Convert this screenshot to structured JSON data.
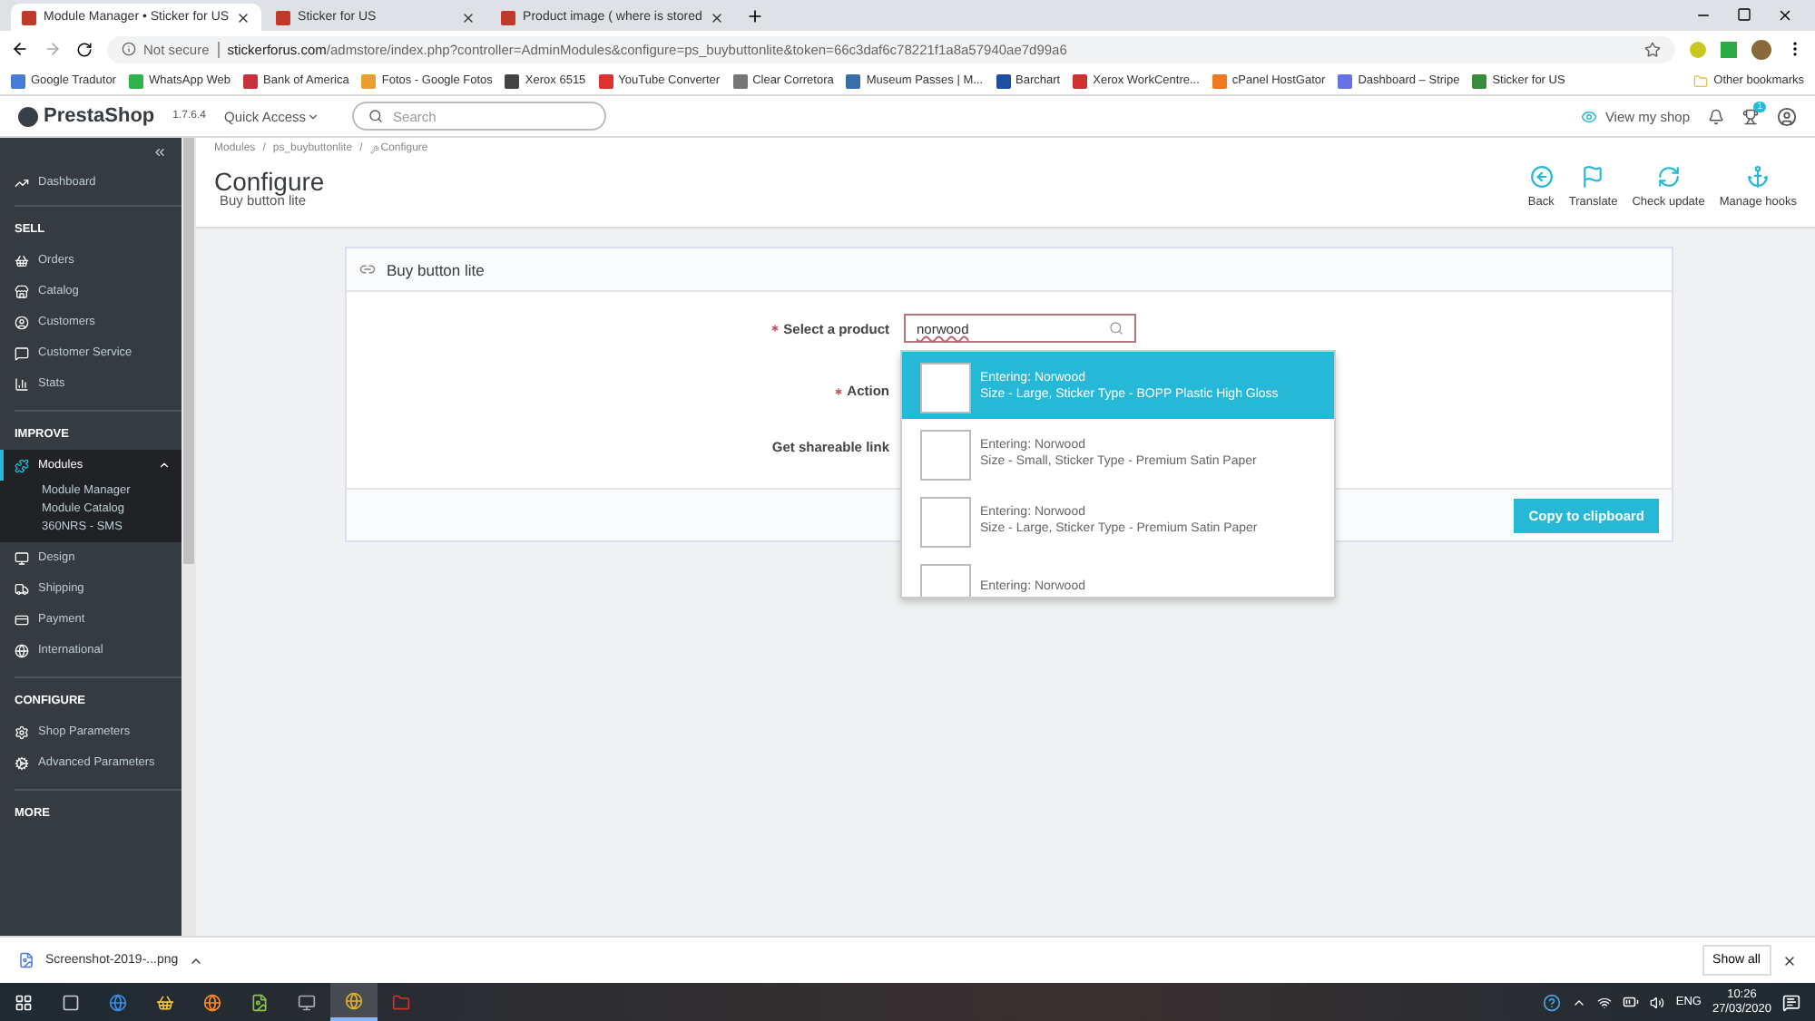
{
  "browser": {
    "tabs": [
      {
        "title": "Module Manager • Sticker for US",
        "selected": true
      },
      {
        "title": "Sticker for US",
        "selected": false
      },
      {
        "title": "Product image ( where is stored",
        "selected": false
      }
    ],
    "security": "Not secure",
    "url_domain": "stickerforus.com",
    "url_path": "/admstore/index.php?controller=AdminModules&configure=ps_buybuttonlite&token=66c3daf6c78221f1a8a57940ae7d99a6",
    "bookmarks": [
      {
        "label": "Google Tradutor",
        "color": "#4a7bd8"
      },
      {
        "label": "WhatsApp Web",
        "color": "#2fb34a"
      },
      {
        "label": "Bank of America",
        "color": "#c8323c"
      },
      {
        "label": "Fotos - Google Fotos",
        "color": "#e8a02a"
      },
      {
        "label": "Xerox 6515",
        "color": "#444444"
      },
      {
        "label": "YouTube Converter",
        "color": "#e03030"
      },
      {
        "label": "Clear Corretora",
        "color": "#777777"
      },
      {
        "label": "Museum Passes | M...",
        "color": "#3a6ea8"
      },
      {
        "label": "Barchart",
        "color": "#1e4ea0"
      },
      {
        "label": "Xerox WorkCentre...",
        "color": "#d03030"
      },
      {
        "label": "cPanel HostGator",
        "color": "#f07a20"
      },
      {
        "label": "Dashboard – Stripe",
        "color": "#6772e5"
      },
      {
        "label": "Sticker for US",
        "color": "#3c8a3c"
      }
    ],
    "other_bookmarks": "Other bookmarks"
  },
  "header": {
    "logo": "PrestaShop",
    "version": "1.7.6.4",
    "quick_access": "Quick Access",
    "search": {
      "placeholder": "Search"
    },
    "view_shop": "View my shop",
    "trophy_badge": "1"
  },
  "sidebar": {
    "sections": [
      {
        "items": [
          {
            "label": "Dashboard",
            "selected": false
          }
        ]
      },
      {
        "title": "SELL",
        "items": [
          {
            "label": "Orders",
            "selected": false
          },
          {
            "label": "Catalog",
            "selected": false
          },
          {
            "label": "Customers",
            "selected": false
          },
          {
            "label": "Customer Service",
            "selected": false
          },
          {
            "label": "Stats",
            "selected": false
          }
        ]
      },
      {
        "title": "IMPROVE",
        "items": [
          {
            "label": "Modules",
            "selected": true,
            "expanded": true,
            "children": [
              {
                "label": "Module Manager"
              },
              {
                "label": "Module Catalog"
              },
              {
                "label": "360NRS - SMS"
              }
            ]
          },
          {
            "label": "Design",
            "selected": false
          },
          {
            "label": "Shipping",
            "selected": false
          },
          {
            "label": "Payment",
            "selected": false
          },
          {
            "label": "International",
            "selected": false
          }
        ]
      },
      {
        "title": "CONFIGURE",
        "items": [
          {
            "label": "Shop Parameters",
            "selected": false
          },
          {
            "label": "Advanced Parameters",
            "selected": false
          }
        ]
      },
      {
        "title": "MORE"
      }
    ]
  },
  "breadcrumb": [
    {
      "kind": "link",
      "text": "Modules"
    },
    {
      "kind": "separator",
      "text": "/"
    },
    {
      "kind": "link",
      "text": "ps_buybuttonlite"
    },
    {
      "kind": "separator",
      "text": "/"
    },
    {
      "kind": "current",
      "text": "Configure"
    }
  ],
  "page": {
    "title": "Configure",
    "subtitle": "Buy button lite"
  },
  "toolbar": [
    {
      "label": "Back",
      "kind": "back"
    },
    {
      "label": "Translate",
      "kind": "translate"
    },
    {
      "label": "Check update",
      "kind": "update"
    },
    {
      "label": "Manage hooks",
      "kind": "hooks"
    }
  ],
  "panel": {
    "title": "Buy button lite",
    "fields": [
      {
        "label": "Select a product",
        "required": true,
        "value": "norwood"
      },
      {
        "label": "Action",
        "required": true
      },
      {
        "label": "Get shareable link",
        "required": false
      }
    ],
    "button": "Copy to clipboard"
  },
  "suggestions": [
    {
      "name": "Entering: Norwood",
      "variant": "Size - Large, Sticker Type - BOPP Plastic High Gloss",
      "selected": true
    },
    {
      "name": "Entering: Norwood",
      "variant": "Size - Small, Sticker Type - Premium Satin Paper",
      "selected": false
    },
    {
      "name": "Entering: Norwood",
      "variant": "Size - Large, Sticker Type - Premium Satin Paper",
      "selected": false
    },
    {
      "name": "Entering: Norwood",
      "selected": false
    }
  ],
  "downloads": {
    "file": "Screenshot-2019-...png",
    "show_all": "Show all"
  },
  "taskbar": {
    "apps": [
      {
        "kind": "start",
        "active": false
      },
      {
        "kind": "taskview",
        "active": false
      },
      {
        "kind": "edge",
        "active": false
      },
      {
        "kind": "store",
        "active": false
      },
      {
        "kind": "firefox",
        "active": false
      },
      {
        "kind": "notepad",
        "active": false
      },
      {
        "kind": "window",
        "active": false
      },
      {
        "kind": "chrome",
        "active": true
      },
      {
        "kind": "filezilla",
        "active": false
      }
    ],
    "language": "ENG",
    "time": "10:26",
    "date": "27/03/2020"
  }
}
